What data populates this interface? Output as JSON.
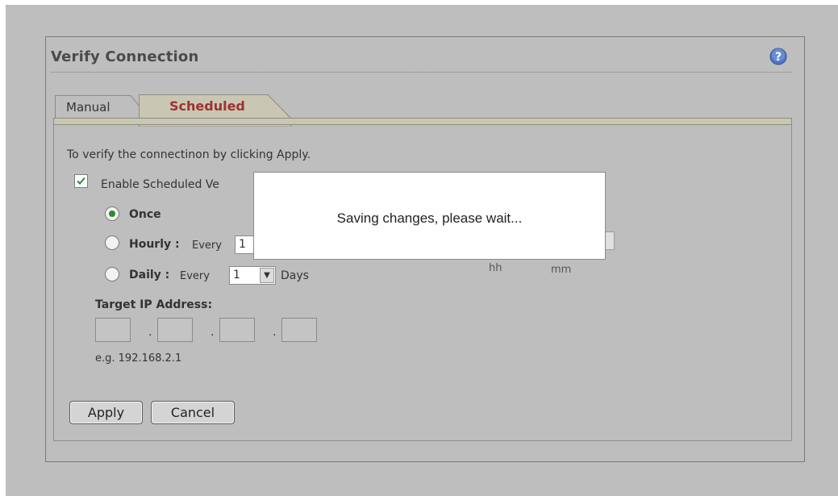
{
  "header": {
    "title": "Verify Connection",
    "help_icon": "help-icon"
  },
  "tabs": [
    {
      "label": "Manual",
      "active": false
    },
    {
      "label": "Scheduled",
      "active": true
    }
  ],
  "form": {
    "intro": "To verify the connectinon by clicking Apply.",
    "enable_label": "Enable Scheduled Ve",
    "enable_checked": true,
    "once_label": "Once",
    "hourly_label": "Hourly :",
    "hourly_every": "Every",
    "hourly_value": "1",
    "daily_label": "Daily :",
    "daily_every": "Every",
    "daily_value": "1",
    "daily_unit": "Days",
    "hh_label": "hh",
    "mm_label": "mm",
    "selected_mode": "Once",
    "target_ip_label": "Target IP Address:",
    "ip_octets": [
      "",
      "",
      "",
      ""
    ],
    "ip_separator": ".",
    "ip_example": "e.g. 192.168.2.1"
  },
  "buttons": {
    "apply": "Apply",
    "cancel": "Cancel"
  },
  "modal": {
    "message": "Saving changes, please wait..."
  },
  "colors": {
    "background": "#bebebe",
    "active_tab_text": "#a03030",
    "radio_selected": "#2f8a2f",
    "check": "#2f8a2f"
  }
}
